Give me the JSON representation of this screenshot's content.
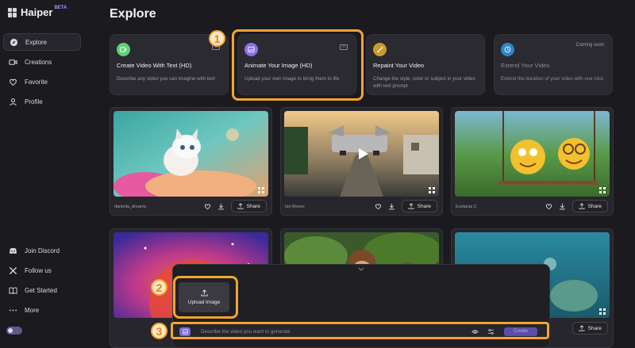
{
  "app": {
    "name": "Haiper",
    "beta": "BETA"
  },
  "sidebar": {
    "items": [
      {
        "label": "Explore",
        "icon": "compass-icon",
        "active": true
      },
      {
        "label": "Creations",
        "icon": "video-icon"
      },
      {
        "label": "Favorite",
        "icon": "heart-icon"
      },
      {
        "label": "Profile",
        "icon": "user-icon"
      }
    ],
    "bottom": [
      {
        "label": "Join Discord",
        "icon": "discord-icon"
      },
      {
        "label": "Follow us",
        "icon": "x-icon"
      },
      {
        "label": "Get Started",
        "icon": "book-icon"
      },
      {
        "label": "More",
        "icon": "more-icon"
      }
    ]
  },
  "main": {
    "title": "Explore",
    "features": [
      {
        "title": "Create Video With Text (HD)",
        "desc": "Describe any video you can imagine with text",
        "icon": "text-to-video-icon",
        "color": "#5fd07a"
      },
      {
        "title": "Animate Your Image (HD)",
        "desc": "Upload your own image to bring them to life",
        "icon": "image-animate-icon",
        "color": "#8a6fe6"
      },
      {
        "title": "Repaint Your Video",
        "desc": "Change the style, color or subject in your video with text prompt",
        "icon": "paint-brush-icon",
        "color": "#c99a2e"
      },
      {
        "title": "Extend Your Video",
        "desc": "Extend the duration of your video with one click",
        "icon": "clock-icon",
        "color": "#2f86c9",
        "badge": "Coming soon"
      }
    ],
    "videos": [
      {
        "author": "daniella_dreamz",
        "share": "Share",
        "theme": "white-kitten"
      },
      {
        "author": "Ian Moore",
        "share": "Share",
        "theme": "flying-car-street"
      },
      {
        "author": "Eustacia C",
        "share": "Share",
        "theme": "emoji-swing"
      },
      {
        "author": "",
        "share": "",
        "theme": "cosmic-planet"
      },
      {
        "author": "",
        "share": "",
        "theme": "jungle-monkeys"
      },
      {
        "author": "",
        "share": "Share",
        "theme": "underwater-reef"
      }
    ]
  },
  "generator": {
    "upload_label": "Upload Image",
    "prompt_placeholder": "Describe the video you want to generate",
    "create_label": "Create"
  },
  "annotations": [
    "1",
    "2",
    "3"
  ],
  "colors": {
    "accent": "#f3a431",
    "brand": "#7b6bd4",
    "background": "#1b1b1f"
  }
}
